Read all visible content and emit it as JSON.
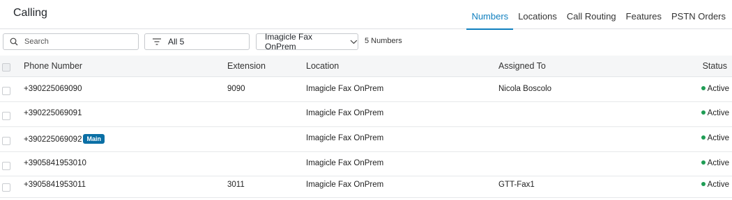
{
  "header": {
    "title": "Calling",
    "tabs": [
      {
        "label": "Numbers",
        "active": true
      },
      {
        "label": "Locations",
        "active": false
      },
      {
        "label": "Call Routing",
        "active": false
      },
      {
        "label": "Features",
        "active": false
      },
      {
        "label": "PSTN Orders",
        "active": false
      }
    ]
  },
  "toolbar": {
    "search_placeholder": "Search",
    "search_value": "",
    "filter_label": "All 5",
    "location_select": "Imagicle Fax OnPrem",
    "count_label": "5 Numbers"
  },
  "table": {
    "columns": [
      "Phone Number",
      "Extension",
      "Location",
      "Assigned To",
      "Status"
    ],
    "rows": [
      {
        "phone": "+390225069090",
        "badge": "",
        "extension": "9090",
        "location": "Imagicle Fax OnPrem",
        "assigned": "Nicola Boscolo",
        "status": "Active"
      },
      {
        "phone": "+390225069091",
        "badge": "",
        "extension": "",
        "location": "Imagicle Fax OnPrem",
        "assigned": "",
        "status": "Active"
      },
      {
        "phone": "+390225069092",
        "badge": "Main",
        "extension": "",
        "location": "Imagicle Fax OnPrem",
        "assigned": "",
        "status": "Active"
      },
      {
        "phone": "+3905841953010",
        "badge": "",
        "extension": "",
        "location": "Imagicle Fax OnPrem",
        "assigned": "",
        "status": "Active"
      },
      {
        "phone": "+3905841953011",
        "badge": "",
        "extension": "3011",
        "location": "Imagicle Fax OnPrem",
        "assigned": "GTT-Fax1",
        "status": "Active"
      }
    ]
  },
  "colors": {
    "accent": "#0f7fbf",
    "badge": "#0a6fa5",
    "status_active": "#1f9d55"
  },
  "icons": {
    "search": "search-icon",
    "filter": "filter-icon",
    "dropdown": "chevron-down-icon",
    "status": "status-dot-icon"
  }
}
